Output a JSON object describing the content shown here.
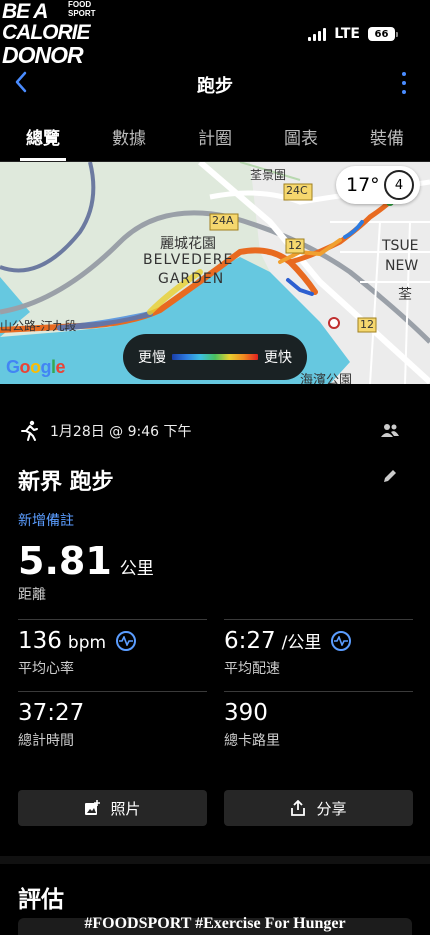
{
  "watermark": {
    "line1": "BE A",
    "line2": "CALORIE",
    "line3": "DONOR",
    "brand_top": "FOOD",
    "brand_bottom": "SPORT",
    "footer": "#FOODSPORT #Exercise For Hunger"
  },
  "status_bar": {
    "network": "LTE",
    "battery": "66"
  },
  "header": {
    "title": "跑步"
  },
  "tabs": [
    {
      "label": "總覽",
      "active": true
    },
    {
      "label": "數據",
      "active": false
    },
    {
      "label": "計圈",
      "active": false
    },
    {
      "label": "圖表",
      "active": false
    },
    {
      "label": "裝備",
      "active": false
    }
  ],
  "map": {
    "labels": {
      "road_top": "荃景圍",
      "route_24c": "24C",
      "route_24a": "24A",
      "route_12a": "12",
      "route_12b": "12",
      "estate_zh": "麗城花園",
      "estate_en1": "BELVEDERE",
      "estate_en2": "GARDEN",
      "district_en1": "TSUE",
      "district_en2": "NEW",
      "district_zh": "荃",
      "road_left": "山公路-汀九段",
      "park": "海濱公園"
    },
    "weather": {
      "temperature": "17°",
      "uv": "4"
    },
    "google": "Google",
    "pace_legend": {
      "slow": "更慢",
      "fast": "更快"
    }
  },
  "activity": {
    "datetime": "1月28日 @ 9:46 下午",
    "title": "新界 跑步",
    "add_note": "新增備註",
    "distance": {
      "value": "5.81",
      "unit": "公里",
      "label": "距離"
    },
    "stats": [
      {
        "value": "136",
        "unit": "bpm",
        "label": "平均心率",
        "has_icon": true
      },
      {
        "value": "6:27",
        "unit": "/公里",
        "label": "平均配速",
        "has_icon": true
      },
      {
        "value": "37:27",
        "unit": "",
        "label": "總計時間",
        "has_icon": false
      },
      {
        "value": "390",
        "unit": "",
        "label": "總卡路里",
        "has_icon": false
      }
    ],
    "buttons": {
      "photos": "照片",
      "share": "分享"
    }
  },
  "evaluation": {
    "title": "評估"
  },
  "colors": {
    "accent": "#5b9dff",
    "water": "#66c8e0",
    "land": "#dfe9dc"
  }
}
